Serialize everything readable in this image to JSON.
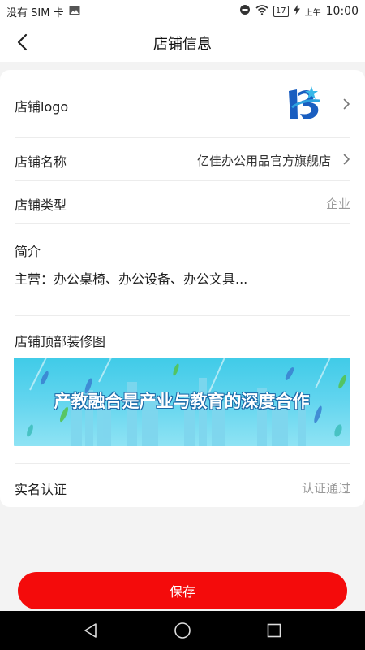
{
  "status_bar": {
    "sim_text": "没有 SIM 卡",
    "battery": "17",
    "ampm": "上午",
    "time": "10:00"
  },
  "header": {
    "title": "店铺信息"
  },
  "store": {
    "logo_label": "店铺logo",
    "name_label": "店铺名称",
    "name_value": "亿佳办公用品官方旗舰店",
    "type_label": "店铺类型",
    "type_value": "企业",
    "intro_label": "简介",
    "intro_value": "主营：办公桌椅、办公设备、办公文具...",
    "banner_label": "店铺顶部装修图",
    "banner_text": "产教融合是产业与教育的深度合作",
    "auth_label": "实名认证",
    "auth_value": "认证通过"
  },
  "footer": {
    "save_label": "保存"
  },
  "colors": {
    "accent": "#f40b0b",
    "muted_text": "#999999",
    "page_bg": "#f3f3f3"
  }
}
